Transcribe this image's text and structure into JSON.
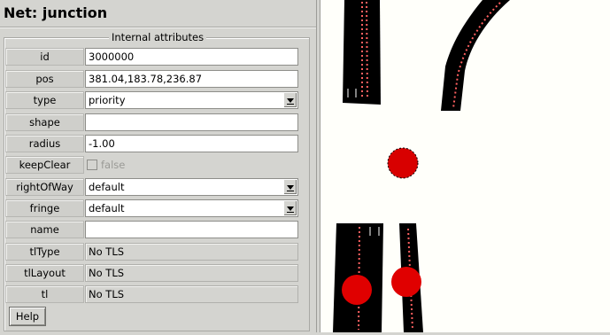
{
  "panel": {
    "title": "Net: junction",
    "group_title": "Internal attributes",
    "help_label": "Help"
  },
  "attributes": {
    "id": {
      "label": "id",
      "value": "3000000"
    },
    "pos": {
      "label": "pos",
      "value": "381.04,183.78,236.87"
    },
    "type": {
      "label": "type",
      "value": "priority"
    },
    "shape": {
      "label": "shape",
      "value": ""
    },
    "radius": {
      "label": "radius",
      "value": "-1.00"
    },
    "keepClear": {
      "label": "keepClear",
      "value": "false",
      "checked": false
    },
    "rightOfWay": {
      "label": "rightOfWay",
      "value": "default"
    },
    "fringe": {
      "label": "fringe",
      "value": "default"
    },
    "name": {
      "label": "name",
      "value": ""
    },
    "tlType": {
      "label": "tlType",
      "value": "No TLS"
    },
    "tlLayout": {
      "label": "tlLayout",
      "value": "No TLS"
    },
    "tl": {
      "label": "tl",
      "value": "No TLS"
    }
  },
  "colors": {
    "junction_selected": "#e00000",
    "junction": "#d80000",
    "road": "#000000",
    "lane_marking": "#ff6060",
    "canvas": "#fffffa"
  }
}
